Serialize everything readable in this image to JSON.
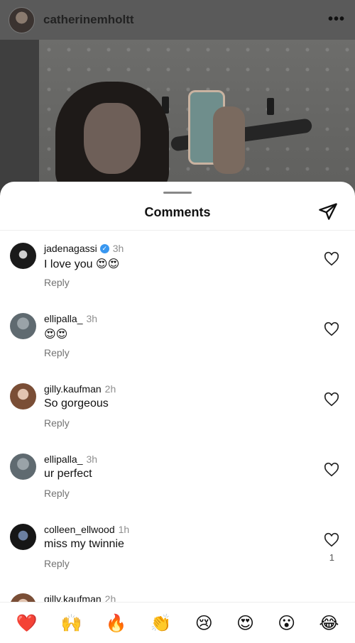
{
  "post": {
    "username": "catherinemholtt",
    "more_icon": "more-horizontal-icon"
  },
  "sheet": {
    "title": "Comments",
    "share_icon": "send-icon"
  },
  "comments": [
    {
      "username": "jadenagassi",
      "verified": true,
      "time": "3h",
      "text": "I love you 😍😍",
      "reply_label": "Reply",
      "likes": ""
    },
    {
      "username": "ellipalla_",
      "verified": false,
      "time": "3h",
      "text": "😍😍",
      "reply_label": "Reply",
      "likes": ""
    },
    {
      "username": "gilly.kaufman",
      "verified": false,
      "time": "2h",
      "text": "So gorgeous",
      "reply_label": "Reply",
      "likes": ""
    },
    {
      "username": "ellipalla_",
      "verified": false,
      "time": "3h",
      "text": "ur perfect",
      "reply_label": "Reply",
      "likes": ""
    },
    {
      "username": "colleen_ellwood",
      "verified": false,
      "time": "1h",
      "text": "miss my twinnie",
      "reply_label": "Reply",
      "likes": "1"
    },
    {
      "username": "gilly.kaufman",
      "verified": false,
      "time": "2h",
      "text": "",
      "reply_label": "",
      "likes": ""
    }
  ],
  "emoji_reactions": [
    "❤️",
    "🙌",
    "🔥",
    "👏",
    "😢",
    "😍",
    "😮",
    "😂"
  ],
  "colors": {
    "verified_badge": "#3897f0",
    "meta_gray": "#8e8e8e",
    "reply_gray": "#737373"
  }
}
